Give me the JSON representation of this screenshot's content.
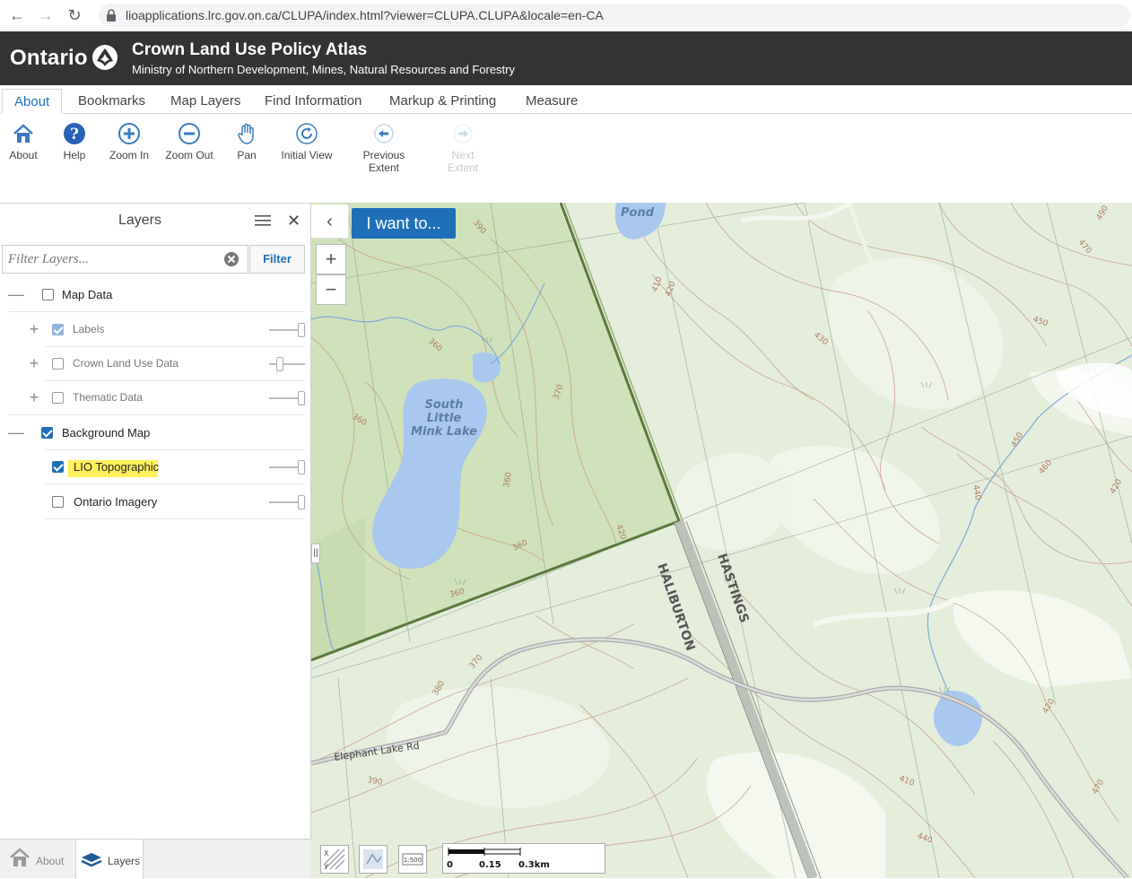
{
  "browser": {
    "url": "lioapplications.lrc.gov.on.ca/CLUPA/index.html?viewer=CLUPA.CLUPA&locale=en-CA"
  },
  "header": {
    "brand": "Ontario",
    "title": "Crown Land Use Policy Atlas",
    "subtitle": "Ministry of Northern Development, Mines, Natural Resources and Forestry"
  },
  "tabs": [
    {
      "label": "About",
      "active": true
    },
    {
      "label": "Bookmarks"
    },
    {
      "label": "Map Layers"
    },
    {
      "label": "Find Information"
    },
    {
      "label": "Markup & Printing"
    },
    {
      "label": "Measure"
    }
  ],
  "toolbar": [
    {
      "label": "About",
      "icon": "home-icon"
    },
    {
      "label": "Help",
      "icon": "help-icon"
    },
    {
      "label": "Zoom In",
      "icon": "zoom-in-icon"
    },
    {
      "label": "Zoom Out",
      "icon": "zoom-out-icon"
    },
    {
      "label": "Pan",
      "icon": "hand-icon"
    },
    {
      "label": "Initial View",
      "icon": "refresh-icon"
    },
    {
      "label": "Previous Extent",
      "icon": "back-arrow-icon"
    },
    {
      "label": "Next Extent",
      "icon": "forward-arrow-icon",
      "disabled": true
    }
  ],
  "layers_panel": {
    "title": "Layers",
    "filter_placeholder": "Filter Layers...",
    "filter_button": "Filter",
    "groups": [
      {
        "label": "Map Data",
        "checked": false,
        "expanded": true,
        "children": [
          {
            "label": "Labels",
            "checked": true,
            "opacity": 1.0
          },
          {
            "label": "Crown Land Use Data",
            "checked": false,
            "opacity": 0.5
          },
          {
            "label": "Thematic Data",
            "checked": false,
            "opacity": 1.0
          }
        ]
      },
      {
        "label": "Background Map",
        "checked": true,
        "expanded": true,
        "children": [
          {
            "label": "LIO Topographic",
            "checked": true,
            "opacity": 1.0,
            "highlighted": true
          },
          {
            "label": "Ontario Imagery",
            "checked": false,
            "opacity": 1.0
          }
        ]
      }
    ],
    "footer_tabs": [
      {
        "label": "About",
        "icon": "home-icon"
      },
      {
        "label": "Layers",
        "icon": "layers-icon",
        "active": true
      }
    ]
  },
  "map": {
    "i_want_to": "I want to...",
    "collapse_icon": "chevron-left-icon",
    "zoom_in": "+",
    "zoom_out": "−",
    "labels": {
      "pond": "Pond",
      "lake_line1": "South",
      "lake_line2": "Little",
      "lake_line3": "Mink Lake",
      "haliburton": "HALIBURTON",
      "hastings": "HASTINGS",
      "road": "Elephant Lake Rd",
      "contours": [
        "390",
        "360",
        "370",
        "360",
        "360",
        "360",
        "360",
        "420",
        "410",
        "420",
        "430",
        "450",
        "470",
        "490",
        "450",
        "460",
        "440",
        "420",
        "370",
        "380",
        "390",
        "410",
        "440",
        "470",
        "420"
      ]
    },
    "scale": {
      "ticks": [
        "0",
        "0.15",
        "0.3km"
      ]
    },
    "scale_button": "1:500"
  },
  "colors": {
    "header_bg": "#333333",
    "accent": "#1e6fb8",
    "map_land": "#e4eedb",
    "map_forest": "#cfe2b9",
    "water": "#a9c8ef",
    "contour": "#c9a08c",
    "highlight": "#fff15a"
  }
}
